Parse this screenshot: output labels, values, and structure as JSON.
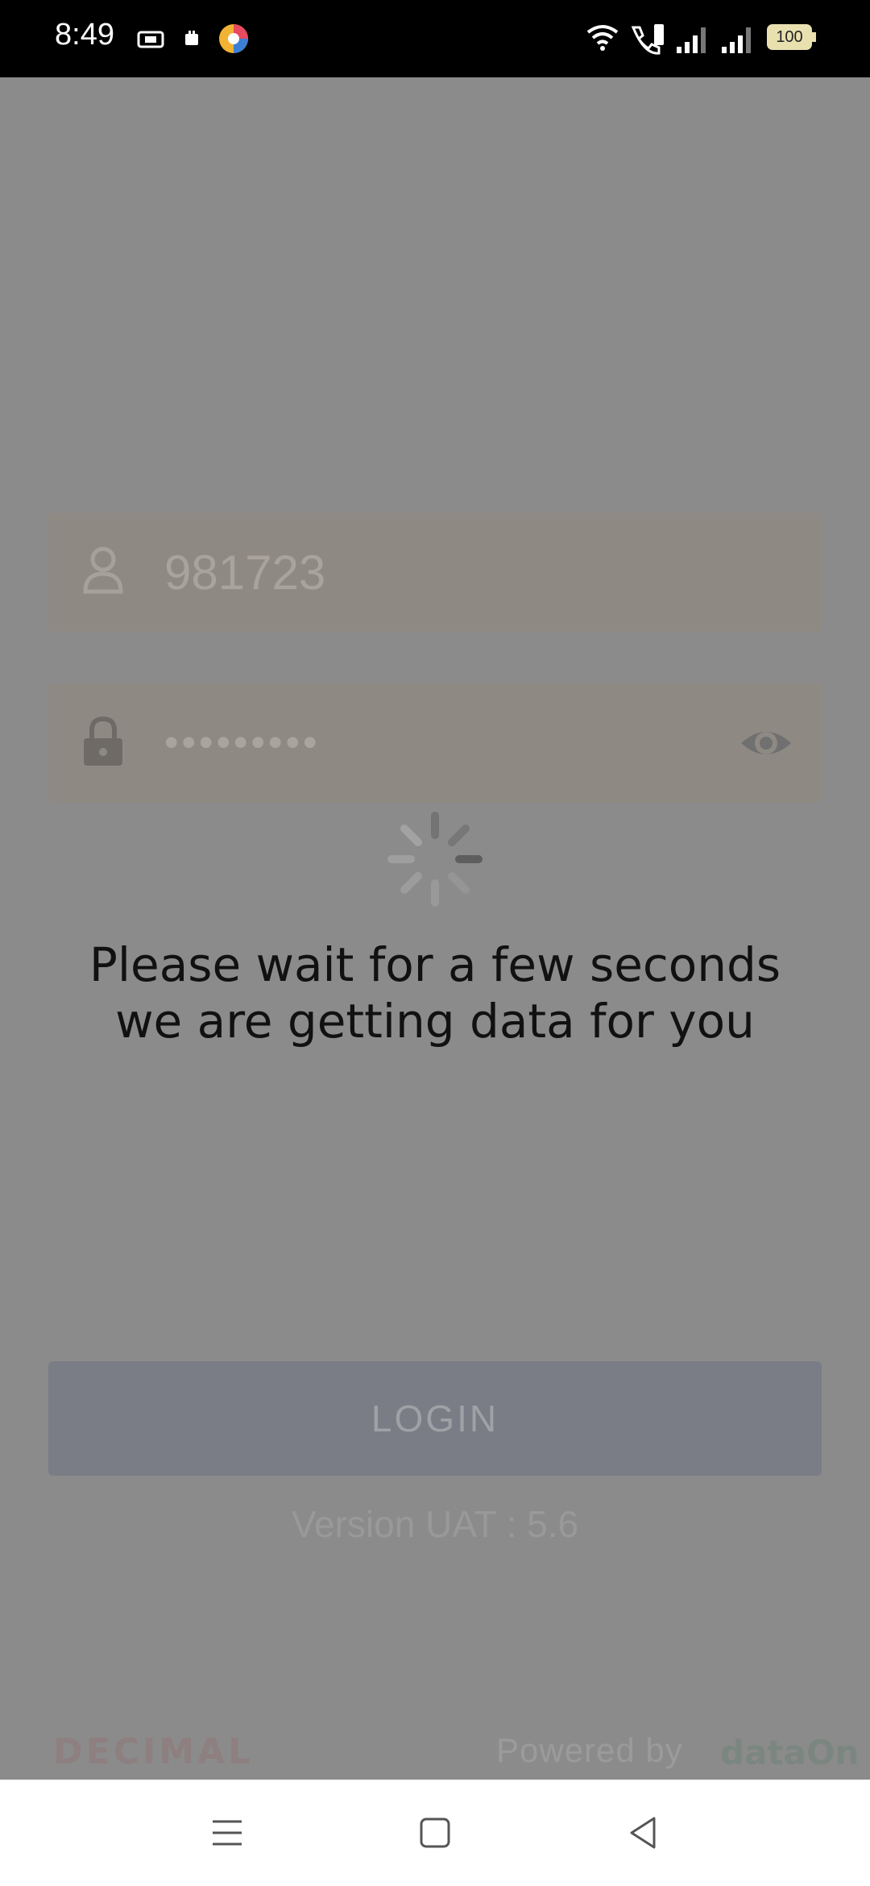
{
  "status_bar": {
    "time": "8:49",
    "battery": "100"
  },
  "login": {
    "username_value": "981723",
    "password_masked": "•••••••••",
    "button_label": "LOGIN",
    "version": "Version UAT : 5.6"
  },
  "overlay": {
    "line1": "Please wait for a few seconds",
    "line2": "we are getting data for you"
  },
  "footer": {
    "brand_left": "DECIMAL",
    "powered_by": "Powered by",
    "brand_right": "dataOn"
  },
  "icons": {
    "user": "user-icon",
    "lock": "lock-icon",
    "eye": "eye-icon",
    "spinner": "loading-spinner-icon",
    "nav_menu": "menu-icon",
    "nav_home": "home-square-icon",
    "nav_back": "back-triangle-icon"
  }
}
